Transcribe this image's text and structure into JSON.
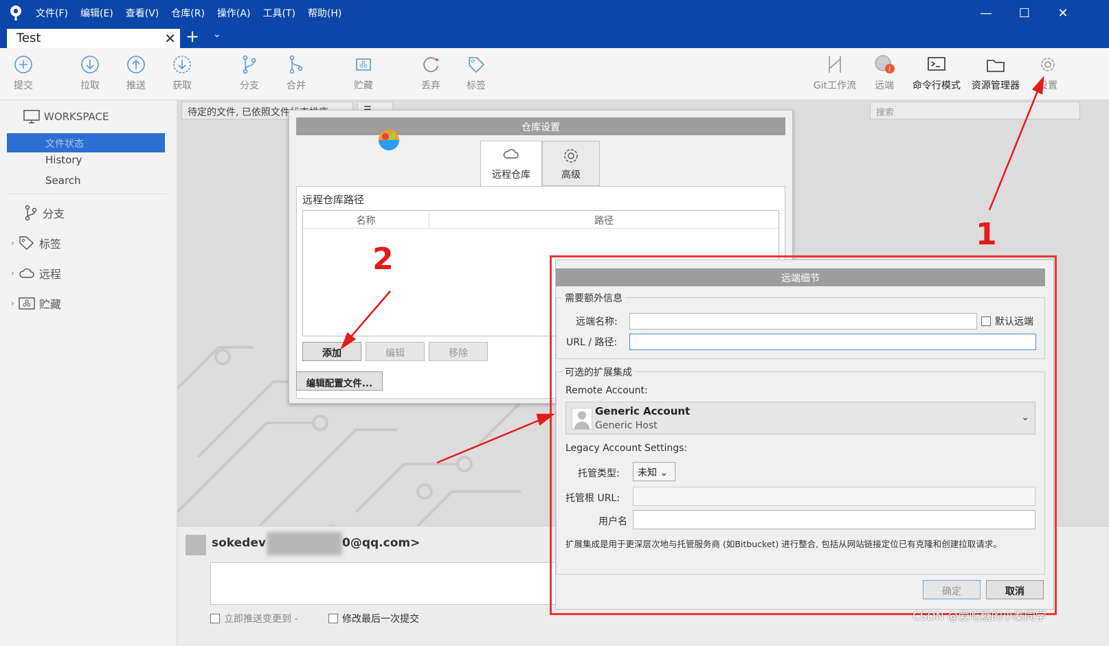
{
  "menu": [
    "文件(F)",
    "编辑(E)",
    "查看(V)",
    "仓库(R)",
    "操作(A)",
    "工具(T)",
    "帮助(H)"
  ],
  "window_controls": {
    "minimize": "—",
    "maximize": "☐",
    "close": "✕"
  },
  "tab": {
    "label": "Test",
    "close": "✕",
    "add": "+",
    "dropdown": "⌄"
  },
  "toolbar_left": [
    {
      "label": "提交",
      "icon": "commit-icon"
    },
    {
      "label": "拉取",
      "icon": "pull-icon"
    },
    {
      "label": "推送",
      "icon": "push-icon"
    },
    {
      "label": "获取",
      "icon": "fetch-icon"
    },
    {
      "label": "分支",
      "icon": "branch-icon"
    },
    {
      "label": "合并",
      "icon": "merge-icon"
    },
    {
      "label": "贮藏",
      "icon": "stash-icon"
    },
    {
      "label": "丢弃",
      "icon": "discard-icon"
    },
    {
      "label": "标签",
      "icon": "tag-icon"
    }
  ],
  "toolbar_right": [
    {
      "label": "Git工作流",
      "icon": "gitflow-icon"
    },
    {
      "label": "远端",
      "icon": "remote-icon"
    },
    {
      "label": "命令行模式",
      "icon": "terminal-icon"
    },
    {
      "label": "资源管理器",
      "icon": "explorer-icon"
    },
    {
      "label": "设置",
      "icon": "settings-gear-icon"
    }
  ],
  "sidebar": {
    "workspace": "WORKSPACE",
    "items": [
      "文件状态",
      "History",
      "Search"
    ],
    "groups": [
      "分支",
      "标签",
      "远程",
      "贮藏"
    ]
  },
  "main": {
    "filter": "待定的文件, 已依照文件状态排序",
    "filter_menu": "☰ ⌄",
    "search_placeholder": "搜索"
  },
  "commit": {
    "author": "sokedev <",
    "email": "0@qq.com>",
    "push_now": "立即推送变更到 -",
    "amend": "修改最后一次提交"
  },
  "repo_dialog": {
    "title": "仓库设置",
    "tabs": [
      "远程仓库",
      "高级"
    ],
    "section": "远程仓库路径",
    "columns": [
      "名称",
      "路径"
    ],
    "buttons": {
      "add": "添加",
      "edit": "编辑",
      "remove": "移除"
    },
    "edit_config": "编辑配置文件..."
  },
  "remote_dialog": {
    "title": "远端细节",
    "required_section": "需要额外信息",
    "remote_name_label": "远端名称:",
    "default_remote": "默认远端",
    "url_label": "URL / 路径:",
    "optional_section": "可选的扩展集成",
    "remote_account_label": "Remote Account:",
    "account_name": "Generic Account",
    "account_host": "Generic Host",
    "legacy_label": "Legacy Account Settings:",
    "hosting_type_label": "托管类型:",
    "hosting_type_value": "未知",
    "base_url_label": "托管根 URL:",
    "username_label": "用户名",
    "description": "扩展集成是用于更深层次地与托管服务商 (如Bitbucket) 进行整合, 包括从网站链接定位已有克隆和创建拉取请求。",
    "ok": "确定",
    "cancel": "取消"
  },
  "annotations": {
    "one": "1",
    "two": "2"
  },
  "watermark": "CSDN @爱吃糖的小秦同学",
  "colors": {
    "titlebar": "#0b46a8",
    "selection": "#2d6fd0",
    "annotation": "#e31b1b"
  }
}
